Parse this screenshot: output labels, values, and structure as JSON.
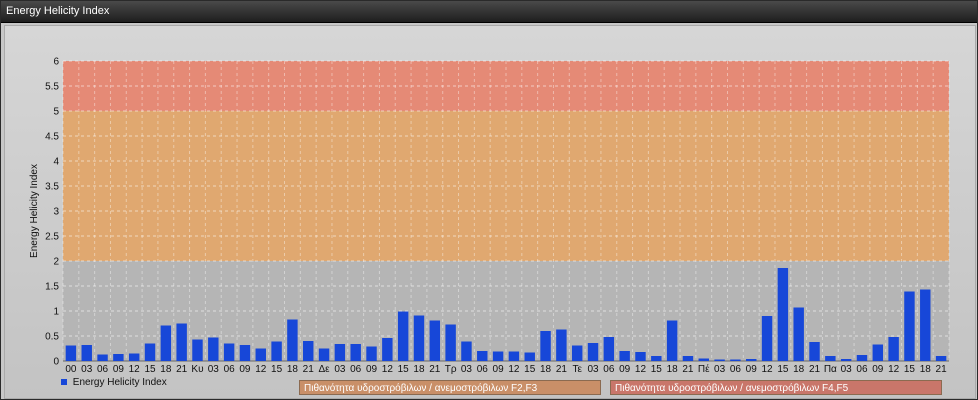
{
  "window": {
    "title": "Energy Helicity Index"
  },
  "legend": {
    "label": "Energy Helicity Index"
  },
  "band_labels": [
    {
      "text": "Πιθανότητα υδροστρόβιλων / ανεμοστρόβιλων F2,F3",
      "color": "#c98f68"
    },
    {
      "text": "Πιθανότητα υδροστρόβιλων / ανεμοστρόβιλων F4,F5",
      "color": "#c9766a"
    }
  ],
  "chart_data": {
    "type": "bar",
    "title": "",
    "xlabel": "",
    "ylabel": "Energy Helicity Index",
    "ylim": [
      0,
      6
    ],
    "yticks": [
      0,
      0.5,
      1,
      1.5,
      2,
      2.5,
      3,
      3.5,
      4,
      4.5,
      5,
      5.5,
      6
    ],
    "grid": true,
    "legend_position": "bottom-left",
    "bar_color": "#1747d8",
    "bands": [
      {
        "from": 0,
        "to": 2,
        "color": "#b5b5b5"
      },
      {
        "from": 2,
        "to": 5,
        "color": "#e0a870"
      },
      {
        "from": 5,
        "to": 6,
        "color": "#e58a76"
      }
    ],
    "categories": [
      "00",
      "03",
      "06",
      "09",
      "12",
      "15",
      "18",
      "21",
      "Κυ",
      "03",
      "06",
      "09",
      "12",
      "15",
      "18",
      "21",
      "Δε",
      "03",
      "06",
      "09",
      "12",
      "15",
      "18",
      "21",
      "Τρ",
      "03",
      "06",
      "09",
      "12",
      "15",
      "18",
      "21",
      "Τε",
      "03",
      "06",
      "09",
      "12",
      "15",
      "18",
      "21",
      "Πέ",
      "03",
      "06",
      "09",
      "12",
      "15",
      "18",
      "21",
      "Πα",
      "03",
      "06",
      "09",
      "12",
      "15",
      "18",
      "21"
    ],
    "series": [
      {
        "name": "Energy Helicity Index",
        "values": [
          0.31,
          0.32,
          0.13,
          0.14,
          0.15,
          0.35,
          0.71,
          0.75,
          0.43,
          0.47,
          0.35,
          0.32,
          0.25,
          0.39,
          0.83,
          0.4,
          0.25,
          0.34,
          0.34,
          0.29,
          0.46,
          0.99,
          0.91,
          0.81,
          0.73,
          0.39,
          0.2,
          0.19,
          0.19,
          0.17,
          0.6,
          0.63,
          0.31,
          0.36,
          0.48,
          0.2,
          0.18,
          0.1,
          0.81,
          0.1,
          0.05,
          0.03,
          0.03,
          0.04,
          0.9,
          1.86,
          1.07,
          0.38,
          0.1,
          0.04,
          0.12,
          0.33,
          0.48,
          1.39,
          1.43,
          0.1
        ]
      }
    ]
  }
}
